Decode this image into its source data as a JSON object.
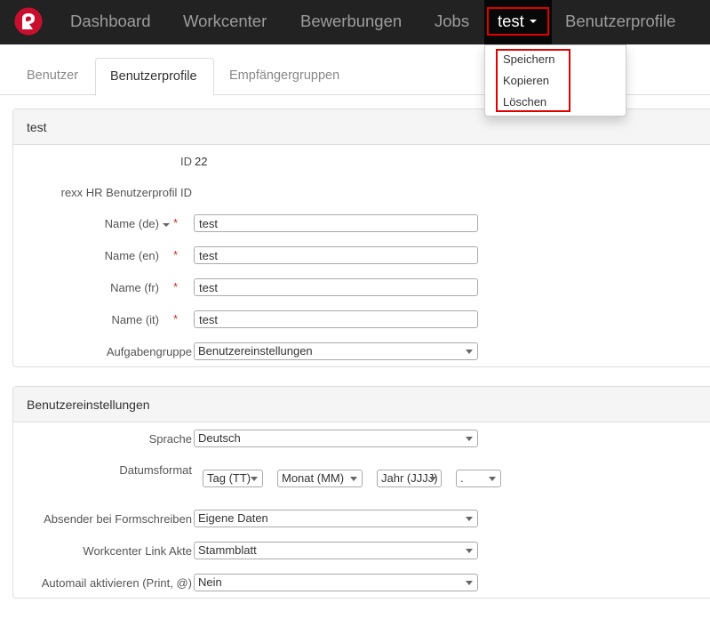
{
  "nav": {
    "items": [
      "Dashboard",
      "Workcenter",
      "Bewerbungen",
      "Jobs"
    ],
    "active_label": "test",
    "last_item": "Benutzerprofile"
  },
  "dropdown": {
    "items": [
      "Speichern",
      "Kopieren",
      "Löschen"
    ]
  },
  "tabs": [
    "Benutzer",
    "Benutzerprofile",
    "Empfängergruppen"
  ],
  "profile_panel": {
    "title": "test",
    "id_label": "ID",
    "id_value": "22",
    "rexx_label": "rexx HR Benutzerprofil ID",
    "rexx_value": "",
    "name_de_label": "Name (de)",
    "name_de_value": "test",
    "name_en_label": "Name (en)",
    "name_en_value": "test",
    "name_fr_label": "Name (fr)",
    "name_fr_value": "test",
    "name_it_label": "Name (it)",
    "name_it_value": "test",
    "required_mark": "*",
    "aufgabengruppe_label": "Aufgabengruppe",
    "aufgabengruppe_value": "Benutzereinstellungen"
  },
  "settings_panel": {
    "title": "Benutzereinstellungen",
    "sprache_label": "Sprache",
    "sprache_value": "Deutsch",
    "datumsformat_label": "Datumsformat",
    "date_day": "Tag (TT)",
    "date_month": "Monat (MM)",
    "date_year": "Jahr (JJJJ)",
    "date_separator": ".",
    "absender_label": "Absender bei Formschreiben",
    "absender_value": "Eigene Daten",
    "workcenter_link_label": "Workcenter Link Akte",
    "workcenter_link_value": "Stammblatt",
    "automail_label": "Automail aktivieren (Print, @)",
    "automail_value": "Nein"
  },
  "colors": {
    "navbar": "#222222",
    "highlight_border": "#e00000",
    "logo_red": "#c8102e"
  },
  "icons": {
    "logo": "rexx-logo-icon"
  }
}
